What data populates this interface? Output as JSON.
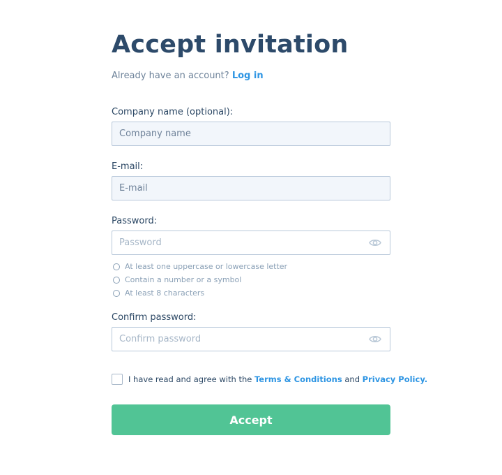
{
  "page": {
    "title": "Accept invitation",
    "subtitle_text": "Already have an account?",
    "login_link": "Log in"
  },
  "form": {
    "company": {
      "label": "Company name (optional):",
      "placeholder": "Company name",
      "value": ""
    },
    "email": {
      "label": "E-mail:",
      "placeholder": "E-mail",
      "value": ""
    },
    "password": {
      "label": "Password:",
      "placeholder": "Password",
      "value": ""
    },
    "password_rules": [
      "At least one uppercase or lowercase letter",
      "Contain a number or a symbol",
      "At least 8 characters"
    ],
    "confirm": {
      "label": "Confirm password:",
      "placeholder": "Confirm password",
      "value": ""
    }
  },
  "agreement": {
    "prefix": "I have read and agree with the",
    "terms_link": "Terms & Conditions",
    "middle": "and",
    "privacy_link": "Privacy Policy.",
    "checked": false
  },
  "accept_button": {
    "label": "Accept"
  },
  "icons": {
    "password_toggle": "eye-icon",
    "confirm_toggle": "eye-icon"
  },
  "colors": {
    "title": "#2d4a6a",
    "link": "#2e95e3",
    "accent_button": "#51c495",
    "input_fill": "#f2f6fb",
    "input_border": "#b8c8da",
    "hint_text": "#8aa0b6"
  }
}
